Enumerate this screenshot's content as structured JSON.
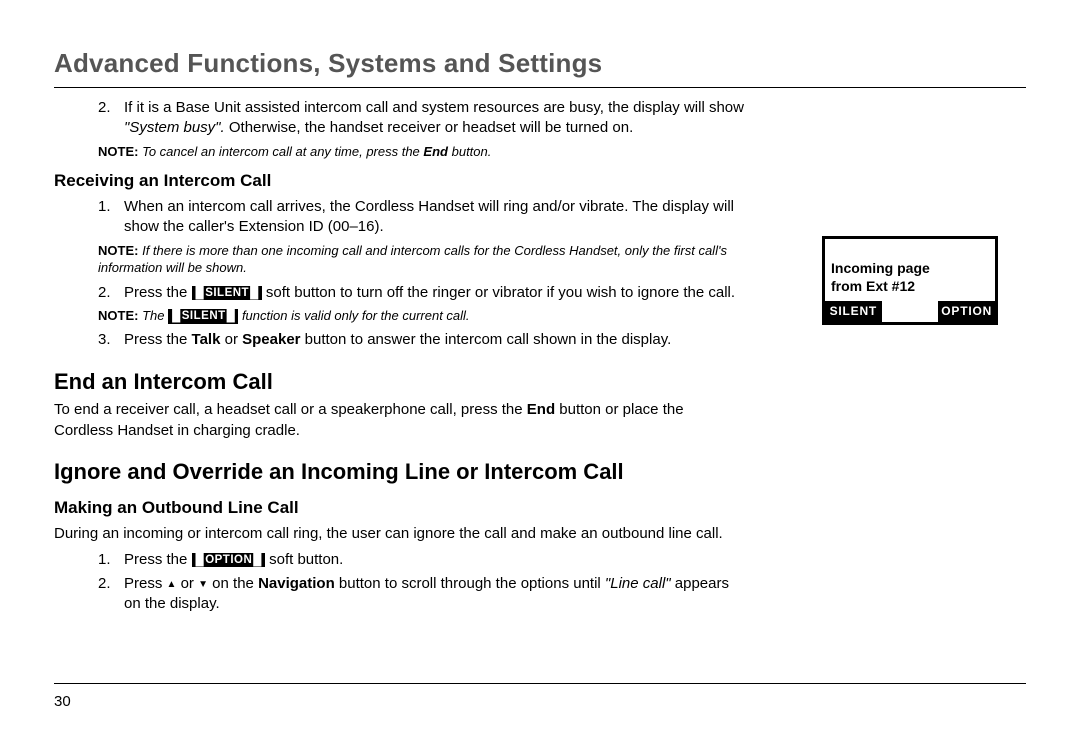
{
  "title": "Advanced Functions, Systems and Settings",
  "step2": {
    "num": "2.",
    "text_a": "If it is a Base Unit assisted intercom call and system resources are busy, the display will show ",
    "text_b": "\"System busy\".",
    "text_c": " Otherwise, the handset receiver or headset will be turned on."
  },
  "note1": {
    "label": "NOTE:",
    "a": "To cancel an intercom call at any time, press the",
    "b": "End",
    "c": "button."
  },
  "recv_head": "Receiving an Intercom Call",
  "recv1": {
    "num": "1.",
    "text": "When an intercom call arrives, the Cordless Handset will ring and/or vibrate. The display will show the caller's Extension ID (00–16)."
  },
  "note2": {
    "label": "NOTE:",
    "text": "If there is more than one incoming call and intercom calls for the Cordless Handset, only the first call's information will be shown."
  },
  "recv2": {
    "num": "2.",
    "a": "Press the ",
    "pill": "SILENT",
    "b": " soft button to turn off the ringer or vibrator if you wish to ignore the call."
  },
  "note3": {
    "label": "NOTE:",
    "a": "The",
    "pill": "SILENT",
    "b": "function is valid only for the current call."
  },
  "recv3": {
    "num": "3.",
    "a": "Press the ",
    "b1": "Talk",
    "mid": " or ",
    "b2": "Speaker",
    "c": " button to answer the intercom call shown in the display."
  },
  "end_head": "End an Intercom Call",
  "end_para": {
    "a": "To end a receiver call, a headset call or a speakerphone call, press the ",
    "b": "End",
    "c": " button or place the Cordless Handset in charging cradle."
  },
  "ign_head": "Ignore and Override an Incoming Line or Intercom Call",
  "make_head": "Making an Outbound Line Call",
  "make_para": "During an incoming or intercom call ring, the user can ignore the call and make an outbound line call.",
  "make1": {
    "num": "1.",
    "a": "Press the ",
    "pill": "OPTION",
    "b": " soft button."
  },
  "make2": {
    "num": "2.",
    "a": "Press ",
    "up": "▲",
    "mid1": " or ",
    "down": "▼",
    "mid2": " on the ",
    "nav": "Navigation",
    "b": " button to scroll through the options until ",
    "lc": "\"Line call\"",
    "c": " appears on the display."
  },
  "lcd": {
    "line1": "Incoming page",
    "line2": "from Ext #12",
    "btn1": "SILENT",
    "btn2": "OPTION"
  },
  "page_num": "30"
}
